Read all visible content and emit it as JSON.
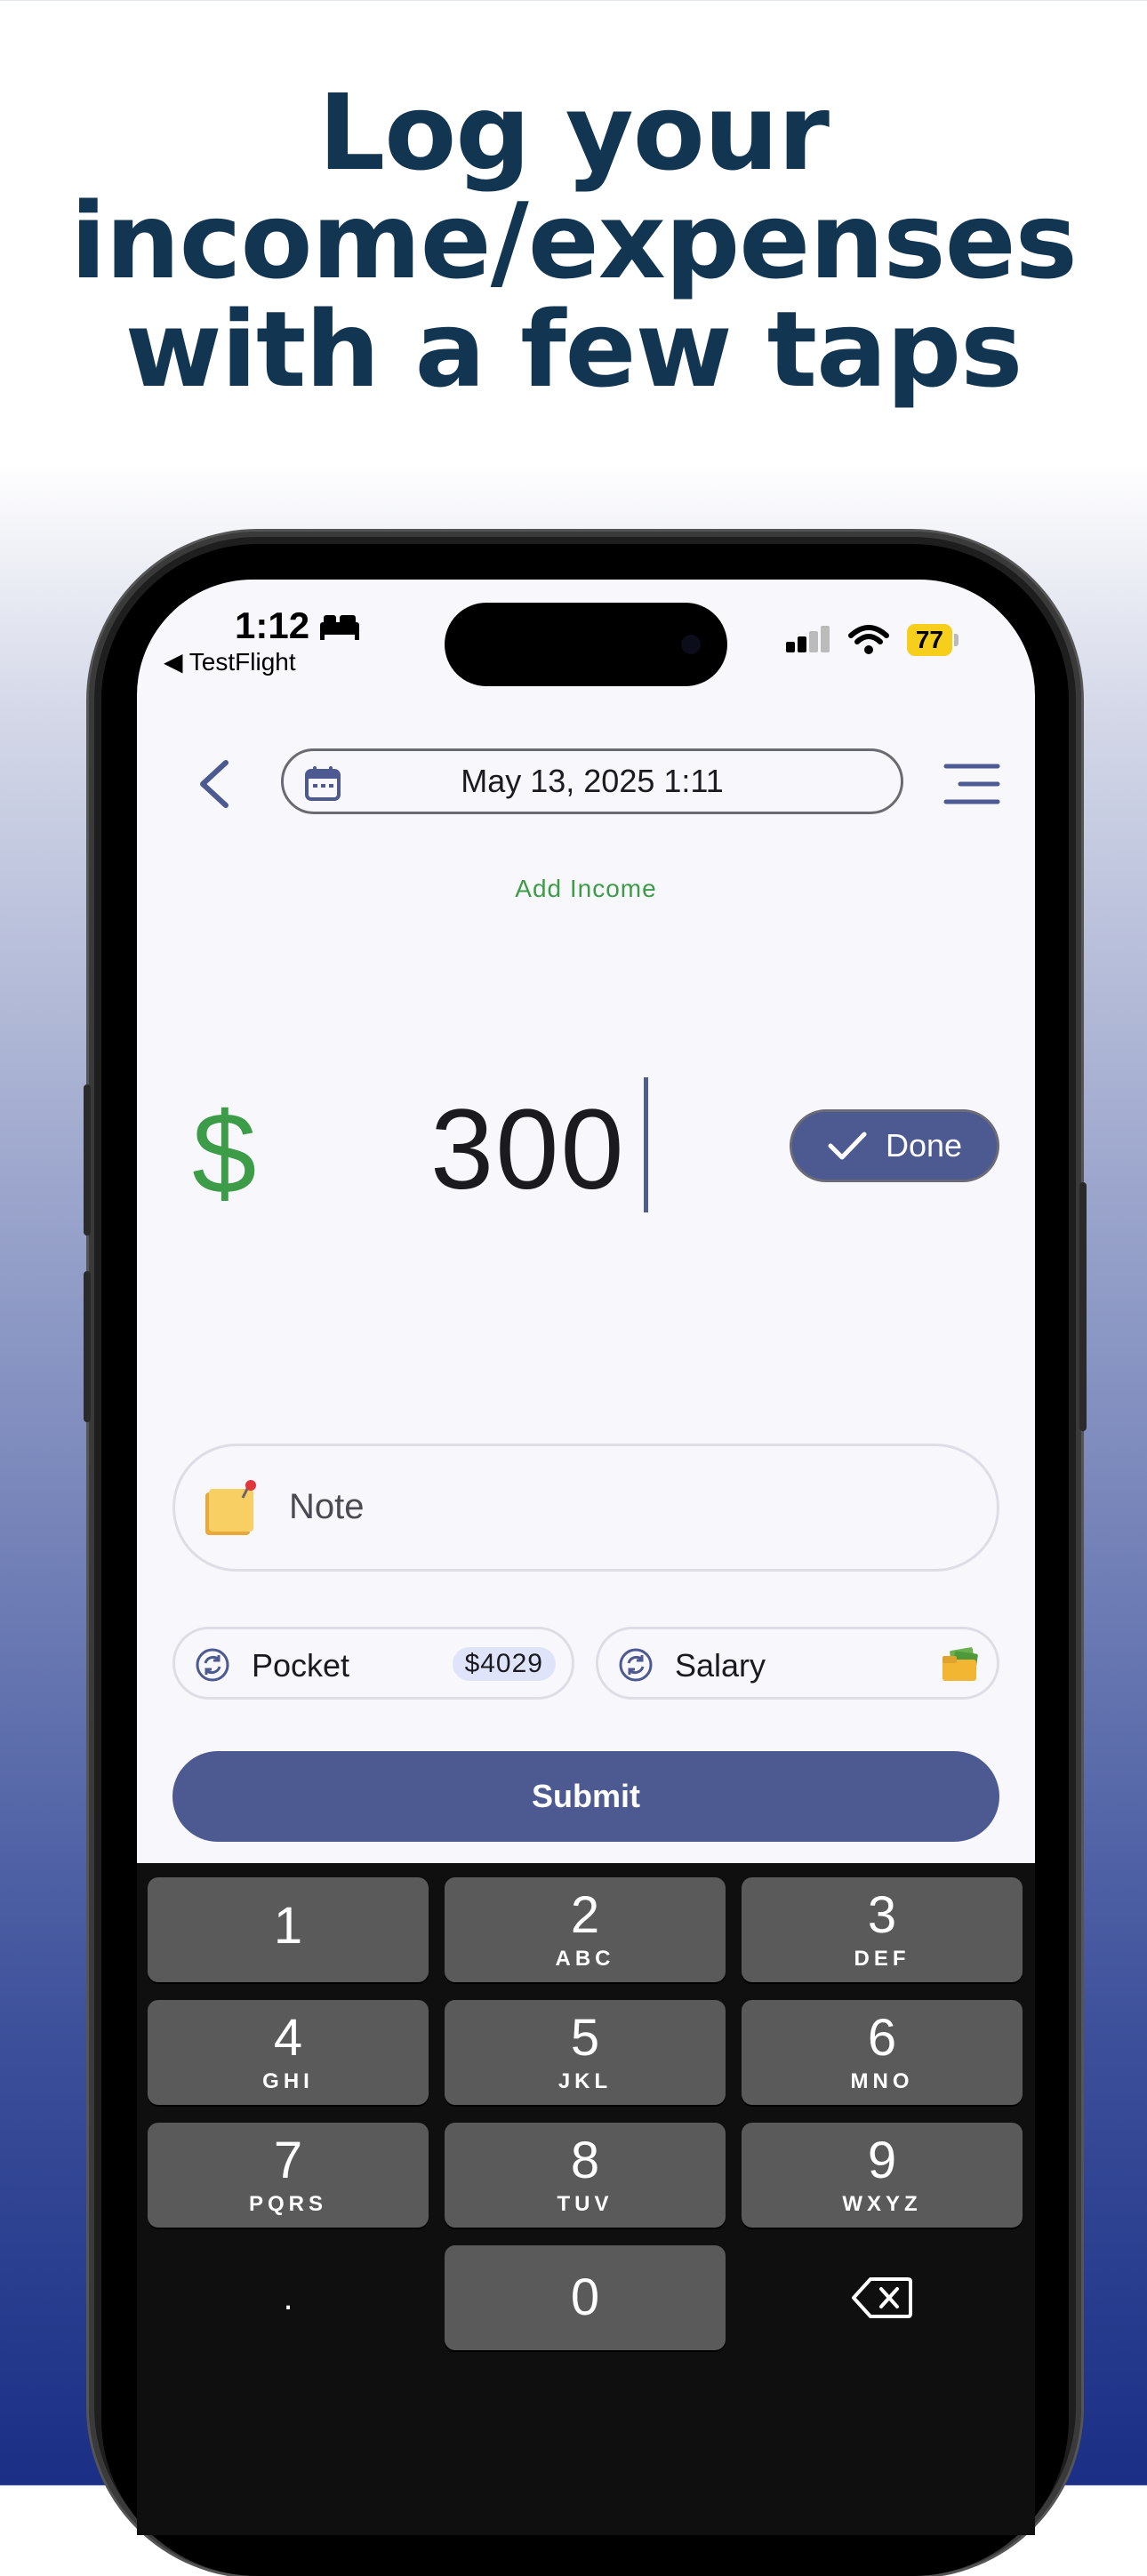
{
  "headline": {
    "line1": "Log your",
    "line2": "income/expenses",
    "line3": "with a few taps"
  },
  "status_bar": {
    "time": "1:12",
    "back_app": "◀ TestFlight",
    "battery": "77"
  },
  "top_bar": {
    "date_time": "May 13, 2025 1:11"
  },
  "mode_label": "Add Income",
  "amount": {
    "currency_symbol": "$",
    "value": "300"
  },
  "done_button": {
    "label": "Done"
  },
  "note_field": {
    "placeholder": "Note"
  },
  "account_chip": {
    "label": "Pocket",
    "balance": "$4029"
  },
  "category_chip": {
    "label": "Salary"
  },
  "submit_button": {
    "label": "Submit"
  },
  "keypad": {
    "keys": [
      {
        "num": "1",
        "letters": ""
      },
      {
        "num": "2",
        "letters": "ABC"
      },
      {
        "num": "3",
        "letters": "DEF"
      },
      {
        "num": "4",
        "letters": "GHI"
      },
      {
        "num": "5",
        "letters": "JKL"
      },
      {
        "num": "6",
        "letters": "MNO"
      },
      {
        "num": "7",
        "letters": "PQRS"
      },
      {
        "num": "8",
        "letters": "TUV"
      },
      {
        "num": "9",
        "letters": "WXYZ"
      },
      {
        "num": "0",
        "letters": ""
      }
    ],
    "decimal": "."
  },
  "colors": {
    "primary": "#4c5a91",
    "income_green": "#3d9c48",
    "headline": "#123552",
    "battery": "#f5cf1c"
  }
}
